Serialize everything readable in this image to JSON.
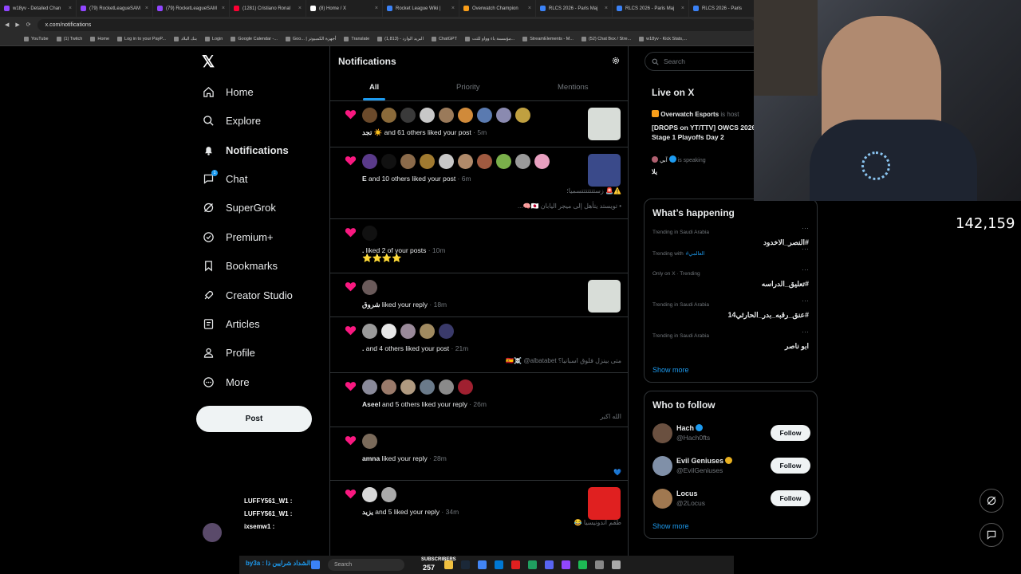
{
  "browser": {
    "tabs": [
      {
        "title": "w18yv - Detailed Chan",
        "color": "#9146ff"
      },
      {
        "title": "(79) RocketLeagueSAM",
        "color": "#9146ff"
      },
      {
        "title": "(79) RocketLeagueSAM",
        "color": "#9146ff"
      },
      {
        "title": "(1281) Cristiano Ronal",
        "color": "#ff0033"
      },
      {
        "title": "(8) Home / X",
        "color": "#ffffff"
      },
      {
        "title": "Rocket League Wiki |",
        "color": "#3b82f6"
      },
      {
        "title": "Overwatch Champion",
        "color": "#f99e1a"
      },
      {
        "title": "RLCS 2026 - Paris Maj",
        "color": "#3b82f6"
      },
      {
        "title": "RLCS 2026 - Paris Maj",
        "color": "#3b82f6"
      },
      {
        "title": "RLCS 2026 - Paris",
        "color": "#3b82f6"
      }
    ],
    "url": "x.com/notifications",
    "bookmarks": [
      "YouTube",
      "(1) Twitch",
      "Home",
      "Log in to your PayP...",
      "بنك البلاد",
      "Login",
      "Google Calendar -...",
      "Goo... | أجهزة الكمبيوتر",
      "Translate",
      "البريد الوارد - (1,813)",
      "ChatGPT",
      "مؤسسة باء وواو للتت...",
      "StreamElements - M...",
      "(52) Chat Box / Stre...",
      "w18yv - Kick Stats,..."
    ]
  },
  "nav": {
    "items": [
      {
        "label": "Home",
        "icon": "home-icon"
      },
      {
        "label": "Explore",
        "icon": "search-icon"
      },
      {
        "label": "Notifications",
        "icon": "bell-icon",
        "active": true
      },
      {
        "label": "Chat",
        "icon": "chat-icon",
        "badge": "1"
      },
      {
        "label": "SuperGrok",
        "icon": "grok-icon"
      },
      {
        "label": "Premium+",
        "icon": "premium-icon"
      },
      {
        "label": "Bookmarks",
        "icon": "bookmark-icon"
      },
      {
        "label": "Creator Studio",
        "icon": "rocket-icon"
      },
      {
        "label": "Articles",
        "icon": "article-icon"
      },
      {
        "label": "Profile",
        "icon": "profile-icon"
      },
      {
        "label": "More",
        "icon": "more-icon"
      }
    ],
    "post_label": "Post"
  },
  "main": {
    "title": "Notifications",
    "tabs": [
      "All",
      "Priority",
      "Mentions"
    ],
    "notifications": [
      {
        "who": "تجد ☀️",
        "rest": " and 61 others liked your post",
        "time": " · 5m",
        "avatars": [
          "#6b4a2b",
          "#8a6a3a",
          "#3a3a3a",
          "#c8c8c8",
          "#9a7a5a",
          "#d08a3a",
          "#5a7ab0",
          "#8a8ab0",
          "#c0a040"
        ],
        "quote": "",
        "quote2": "",
        "thumb": "#d8ddd8"
      },
      {
        "who": "E",
        "rest": " and 10 others liked your post",
        "time": " · 6m",
        "avatars": [
          "#5a3a8a",
          "#111111",
          "#8a6a4a",
          "#a07a30",
          "#c8c8c8",
          "#b08a6a",
          "#a05a40",
          "#7ab04a",
          "#9a9a9a",
          "#e8a0c0"
        ],
        "quote": "⚠️🚨 زستتتتتتتسميا؛",
        "quote2": "• تويستد يتأهل إلى ميجر اليابان 🇯🇵🧠...",
        "thumb": "#3a4a8a"
      },
      {
        "who": ".",
        "rest": " liked 2 of your posts",
        "time": " · 10m",
        "avatars": [
          "#111111"
        ],
        "quote": "",
        "quote2": "⭐⭐⭐⭐",
        "thumb": ""
      },
      {
        "who": "شروق",
        "rest": " liked your reply",
        "time": " · 18m",
        "avatars": [
          "#6a5a5a"
        ],
        "quote": "",
        "quote2": "",
        "thumb": "#d8ddd8"
      },
      {
        "who": ".",
        "rest": " and 4 others liked your post",
        "time": " · 21m",
        "avatars": [
          "#9a9a9a",
          "#e8e8e8",
          "#9a8a9a",
          "#a08a60",
          "#3a3a6a"
        ],
        "quote": "متى بينزل فلوق اسبانيا؟ 🇪🇸☠️ @albatabet",
        "quote2": "",
        "thumb": ""
      },
      {
        "who": "Aseel",
        "rest": " and 5 others liked your reply",
        "time": " · 26m",
        "avatars": [
          "#8a8a9a",
          "#9a7a6a",
          "#b09a80",
          "#6a7a8a",
          "#8a8a8a",
          "#a02030"
        ],
        "quote": "الله اكبر",
        "quote2": "",
        "thumb": ""
      },
      {
        "who": "amna",
        "rest": " liked your reply",
        "time": " · 28m",
        "avatars": [
          "#7a6a5a"
        ],
        "quote": "💙",
        "quote2": "",
        "thumb": ""
      },
      {
        "who": "يزيد",
        "rest": " and 5 liked your reply",
        "time": " · 34m",
        "avatars": [
          "#d8d8d8",
          "#aaaaaa"
        ],
        "quote": "طقم اندونيسيا 😂",
        "quote2": "",
        "thumb": "#e02020"
      }
    ]
  },
  "right": {
    "search_placeholder": "Search",
    "live": {
      "title": "Live on X",
      "host": "Overwatch Esports",
      "host_suffix": " is host",
      "headline": "[DROPS on YT/TTV] OWCS 2026 Stage 1 Playoffs Day 2",
      "speaker": "آبي",
      "speaker_suffix": " is speaking",
      "speaker_text": "يلا"
    },
    "happening": {
      "title": "What’s happening",
      "trends": [
        {
          "meta": "Trending in Saudi Arabia",
          "name": "#النصر_الاخدود"
        },
        {
          "meta": "Trending with",
          "meta_link": "#العالمي",
          "name": ""
        },
        {
          "meta": "Only on X · Trending",
          "name": "#تعليق_الدراسه"
        },
        {
          "meta": "Trending in Saudi Arabia",
          "name": "#عنق_رقبه_بدر_الحارثي14"
        },
        {
          "meta": "Trending in Saudi Arabia",
          "name": "ابو ناصر"
        }
      ],
      "show_more": "Show more"
    },
    "wtf": {
      "title": "Who to follow",
      "accounts": [
        {
          "name": "Hach",
          "handle": "@Hach0fts",
          "verified_color": "#1d9bf0",
          "avatar": "#6a5040"
        },
        {
          "name": "Evil Geniuses",
          "handle": "@EvilGeniuses",
          "verified_color": "#e8b020",
          "avatar": "#8090a8"
        },
        {
          "name": "Locus",
          "handle": "@2Locus",
          "verified_color": "",
          "avatar": "#a07850"
        }
      ],
      "follow_label": "Follow",
      "show_more": "Show more"
    }
  },
  "overlay": {
    "viewer_count": "142,159",
    "chat_lines": [
      "LUFFY561_W1 :",
      "LUFFY561_W1 :",
      "ixsemw1 :"
    ],
    "taskbar_search": "Search",
    "bottom_user": "by3a : الشداد شرايين ذا",
    "subscribers_label": "SUBSCRIBERS",
    "subscribers_count": "257"
  },
  "colors": {
    "accent": "#1d9bf0",
    "heart": "#f91880",
    "border": "#2f3336"
  }
}
